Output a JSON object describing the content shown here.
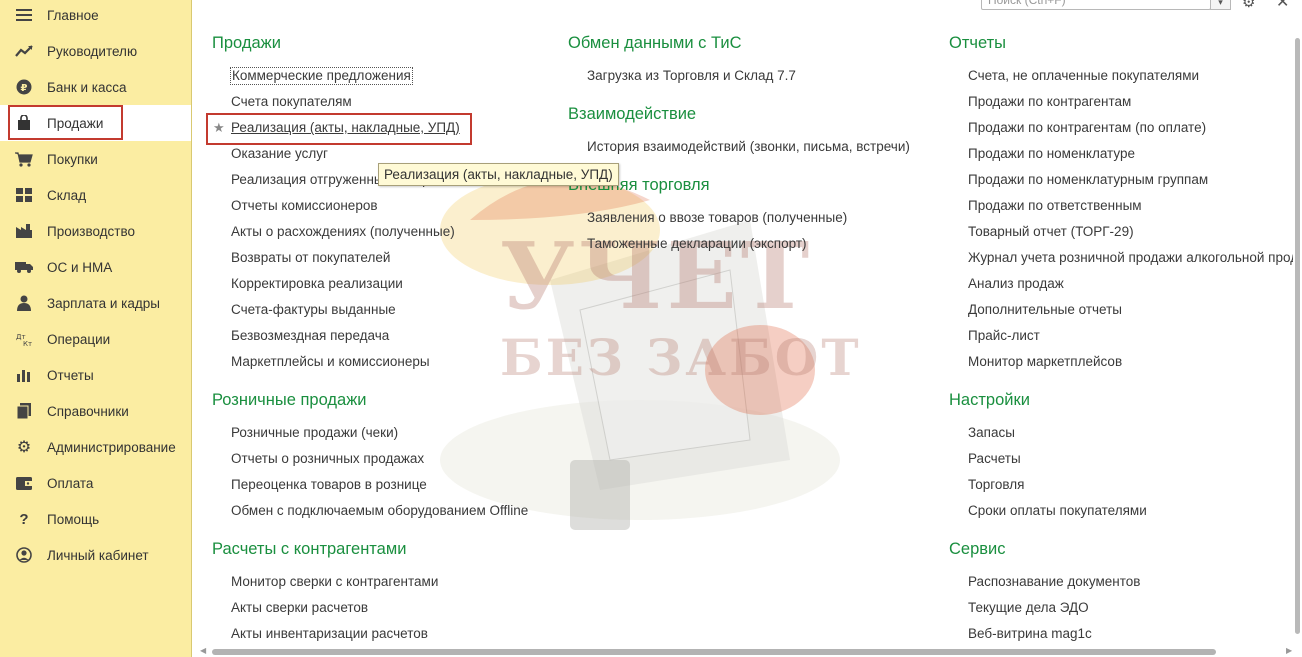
{
  "sidebar": {
    "items": [
      {
        "label": "Главное",
        "icon": "menu-lines-icon"
      },
      {
        "label": "Руководителю",
        "icon": "trend-up-icon"
      },
      {
        "label": "Банк и касса",
        "icon": "ruble-coin-icon"
      },
      {
        "label": "Продажи",
        "icon": "shopping-bag-icon"
      },
      {
        "label": "Покупки",
        "icon": "shopping-cart-icon"
      },
      {
        "label": "Склад",
        "icon": "warehouse-grid-icon"
      },
      {
        "label": "Производство",
        "icon": "factory-icon"
      },
      {
        "label": "ОС и НМА",
        "icon": "truck-icon"
      },
      {
        "label": "Зарплата и кадры",
        "icon": "person-icon"
      },
      {
        "label": "Операции",
        "icon": "dt-kt-icon"
      },
      {
        "label": "Отчеты",
        "icon": "bar-chart-icon"
      },
      {
        "label": "Справочники",
        "icon": "books-icon"
      },
      {
        "label": "Администрирование",
        "icon": "gear-icon"
      },
      {
        "label": "Оплата",
        "icon": "wallet-icon"
      },
      {
        "label": "Помощь",
        "icon": "question-icon"
      },
      {
        "label": "Личный кабинет",
        "icon": "user-circle-icon"
      }
    ],
    "active_index": 3,
    "active_color": "#ffffff",
    "background": "#fbeda2"
  },
  "header": {
    "search_placeholder": "Поиск (Ctrl+F)",
    "search_button": "▾"
  },
  "watermark": {
    "line1": "УЧЕТ",
    "line2": "БЕЗ ЗАБОТ"
  },
  "accent_color": "#1a8f3f",
  "highlight_color": "#c33a2f",
  "col1": {
    "sec_sales": "Продажи",
    "sales": [
      "Коммерческие предложения",
      "Счета покупателям",
      "Реализация (акты, накладные, УПД)",
      "Оказание услуг",
      "Реализация отгруженных товаров",
      "Отчеты комиссионеров",
      "Акты о расхождениях (полученные)",
      "Возвраты от покупателей",
      "Корректировка реализации",
      "Счета-фактуры выданные",
      "Безвозмездная передача",
      "Маркетплейсы и комиссионеры"
    ],
    "sec_retail": "Розничные продажи",
    "retail": [
      "Розничные продажи (чеки)",
      "Отчеты о розничных продажах",
      "Переоценка товаров в рознице",
      "Обмен с подключаемым оборудованием Offline"
    ],
    "sec_settle": "Расчеты с контрагентами",
    "settle": [
      "Монитор сверки с контрагентами",
      "Акты сверки расчетов",
      "Акты инвентаризации расчетов"
    ]
  },
  "col2": {
    "sec_exchange": "Обмен данными с ТиС",
    "exchange": [
      "Загрузка из Торговля и Склад 7.7"
    ],
    "sec_interact": "Взаимодействие",
    "interact": [
      "История взаимодействий (звонки, письма, встречи)"
    ],
    "sec_foreign": "Внешняя торговля",
    "foreign": [
      "Заявления о ввозе товаров (полученные)",
      "Таможенные декларации (экспорт)"
    ]
  },
  "col3": {
    "sec_reports": "Отчеты",
    "reports": [
      "Счета, не оплаченные покупателями",
      "Продажи по контрагентам",
      "Продажи по контрагентам (по оплате)",
      "Продажи по номенклатуре",
      "Продажи по номенклатурным группам",
      "Продажи по ответственным",
      "Товарный отчет (ТОРГ-29)",
      "Журнал учета розничной продажи алкогольной продукции",
      "Анализ продаж",
      "Дополнительные отчеты",
      "Прайс-лист",
      "Монитор маркетплейсов"
    ],
    "sec_settings": "Настройки",
    "settings": [
      "Запасы",
      "Расчеты",
      "Торговля",
      "Сроки оплаты покупателями"
    ],
    "sec_service": "Сервис",
    "service": [
      "Распознавание документов",
      "Текущие дела ЭДО",
      "Веб-витрина mag1c"
    ]
  },
  "tooltip": "Реализация (акты, накладные, УПД)"
}
